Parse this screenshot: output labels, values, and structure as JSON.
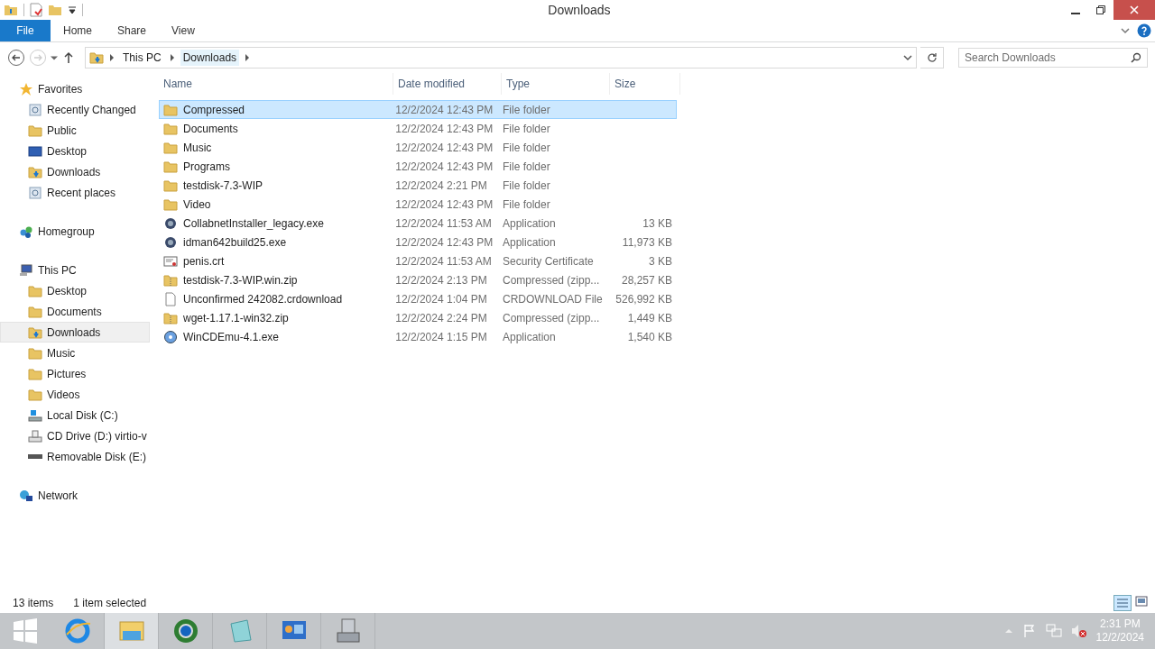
{
  "window": {
    "title": "Downloads"
  },
  "ribbon": {
    "file_tab": "File",
    "tabs": [
      "Home",
      "Share",
      "View"
    ]
  },
  "address": {
    "crumbs": [
      "This PC",
      "Downloads"
    ],
    "search_placeholder": "Search Downloads"
  },
  "sidebar": [
    {
      "label": "Favorites",
      "kind": "star",
      "selected": false,
      "children": [
        {
          "label": "Recently Changed",
          "kind": "recent",
          "selected": false
        },
        {
          "label": "Public",
          "kind": "folder",
          "selected": false
        },
        {
          "label": "Desktop",
          "kind": "desktop",
          "selected": false
        },
        {
          "label": "Downloads",
          "kind": "download",
          "selected": false
        },
        {
          "label": "Recent places",
          "kind": "recent",
          "selected": false
        }
      ]
    },
    {
      "label": "Homegroup",
      "kind": "home",
      "selected": false
    },
    {
      "label": "This PC",
      "kind": "pc",
      "selected": false,
      "children": [
        {
          "label": "Desktop",
          "kind": "folder",
          "selected": false
        },
        {
          "label": "Documents",
          "kind": "folder",
          "selected": false
        },
        {
          "label": "Downloads",
          "kind": "download",
          "selected": true
        },
        {
          "label": "Music",
          "kind": "folder",
          "selected": false
        },
        {
          "label": "Pictures",
          "kind": "folder",
          "selected": false
        },
        {
          "label": "Videos",
          "kind": "folder",
          "selected": false
        },
        {
          "label": "Local Disk (C:)",
          "kind": "disk",
          "selected": false
        },
        {
          "label": "CD Drive (D:) virtio-v",
          "kind": "cd",
          "selected": false
        },
        {
          "label": "Removable Disk (E:)",
          "kind": "usb",
          "selected": false
        }
      ]
    },
    {
      "label": "Network",
      "kind": "network",
      "selected": false
    }
  ],
  "table": {
    "columns": [
      "Name",
      "Date modified",
      "Type",
      "Size"
    ],
    "rows": [
      {
        "name": "Compressed",
        "date": "12/2/2024 12:43 PM",
        "type": "File folder",
        "kind": "folder",
        "selected": true
      },
      {
        "name": "Documents",
        "date": "12/2/2024 12:43 PM",
        "type": "File folder",
        "kind": "folder",
        "selected": false
      },
      {
        "name": "Music",
        "date": "12/2/2024 12:43 PM",
        "type": "File folder",
        "kind": "folder",
        "selected": false
      },
      {
        "name": "Programs",
        "date": "12/2/2024 12:43 PM",
        "type": "File folder",
        "kind": "folder",
        "selected": false
      },
      {
        "name": "testdisk-7.3-WIP",
        "date": "12/2/2024 2:21 PM",
        "type": "File folder",
        "kind": "folder",
        "selected": false
      },
      {
        "name": "Video",
        "date": "12/2/2024 12:43 PM",
        "type": "File folder",
        "kind": "folder",
        "selected": false
      },
      {
        "name": "CollabnetInstaller_legacy.exe",
        "date": "12/2/2024 11:53 AM",
        "type": "Application",
        "size": "13 KB",
        "kind": "app",
        "selected": false
      },
      {
        "name": "idman642build25.exe",
        "date": "12/2/2024 12:43 PM",
        "type": "Application",
        "size": "11,973 KB",
        "kind": "app",
        "selected": false
      },
      {
        "name": "penis.crt",
        "date": "12/2/2024 11:53 AM",
        "type": "Security Certificate",
        "size": "3 KB",
        "kind": "cert",
        "selected": false
      },
      {
        "name": "testdisk-7.3-WIP.win.zip",
        "date": "12/2/2024 2:13 PM",
        "type": "Compressed (zipp...",
        "size": "28,257 KB",
        "kind": "zip",
        "selected": false
      },
      {
        "name": "Unconfirmed 242082.crdownload",
        "date": "12/2/2024 1:04 PM",
        "type": "CRDOWNLOAD File",
        "size": "526,992 KB",
        "kind": "file",
        "selected": false
      },
      {
        "name": "wget-1.17.1-win32.zip",
        "date": "12/2/2024 2:24 PM",
        "type": "Compressed (zipp...",
        "size": "1,449 KB",
        "kind": "zip",
        "selected": false
      },
      {
        "name": "WinCDEmu-4.1.exe",
        "date": "12/2/2024 1:15 PM",
        "type": "Application",
        "size": "1,540 KB",
        "kind": "disc",
        "selected": false
      }
    ]
  },
  "status_bar": {
    "count": "13 items",
    "selection": "1 item selected"
  },
  "taskbar": {
    "apps": [
      {
        "kind": "ie",
        "active": false
      },
      {
        "kind": "explorer",
        "active": true
      },
      {
        "kind": "globe",
        "active": false
      },
      {
        "kind": "notepad",
        "active": false
      },
      {
        "kind": "panel",
        "active": false
      },
      {
        "kind": "server",
        "active": false
      }
    ],
    "time": "2:31 PM",
    "date": "12/2/2024"
  }
}
